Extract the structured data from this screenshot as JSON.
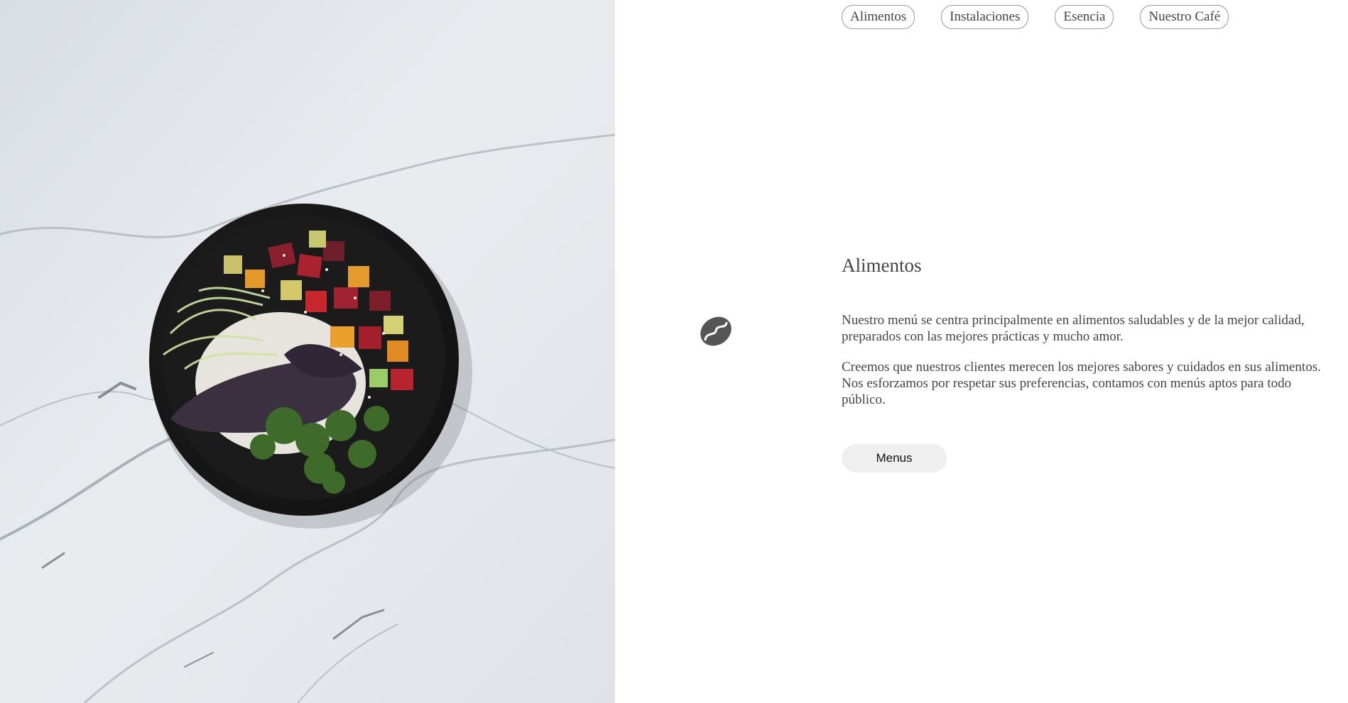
{
  "nav": {
    "items": [
      {
        "label": "Alimentos"
      },
      {
        "label": "Instalaciones"
      },
      {
        "label": "Esencia"
      },
      {
        "label": "Nuestro Café"
      }
    ]
  },
  "hero": {
    "image": "marble-table-poke-bowl-photo"
  },
  "icons": {
    "coffee_bean": "coffee-bean-icon"
  },
  "section": {
    "title": "Alimentos",
    "paragraphs": [
      "Nuestro menú se centra principalmente en alimentos saludables y de la mejor calidad, preparados con las mejores prácticas y mucho amor.",
      "Creemos que nuestros clientes merecen los mejores sabores y cuidados en sus alimentos. Nos esforzamos por respetar sus preferencias, contamos con menús aptos para todo público."
    ],
    "button_label": "Menus"
  },
  "colors": {
    "text": "#444444",
    "button_bg": "#efefef",
    "pill_border": "#9a9a9a",
    "icon": "#555555",
    "marble": "#dde2e7"
  }
}
